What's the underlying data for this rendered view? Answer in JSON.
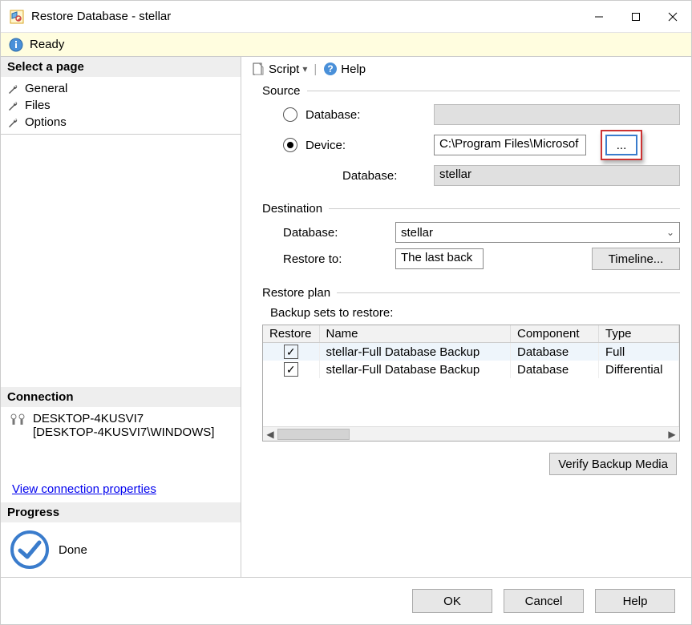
{
  "window": {
    "title": "Restore Database - stellar"
  },
  "status": {
    "text": "Ready"
  },
  "sidebar": {
    "header_pages": "Select a page",
    "pages": [
      {
        "label": "General"
      },
      {
        "label": "Files"
      },
      {
        "label": "Options"
      }
    ],
    "header_connection": "Connection",
    "connection_line1": "DESKTOP-4KUSVI7",
    "connection_line2": "[DESKTOP-4KUSVI7\\WINDOWS]",
    "view_conn_link": "View connection properties",
    "header_progress": "Progress",
    "progress_label": "Done"
  },
  "toolbar": {
    "script_label": "Script",
    "help_label": "Help"
  },
  "source": {
    "header": "Source",
    "database_label": "Database:",
    "device_label": "Device:",
    "device_path": "C:\\Program Files\\Microsof",
    "browse_ellipsis": "...",
    "nested_database_label": "Database:",
    "nested_database_value": "stellar"
  },
  "destination": {
    "header": "Destination",
    "database_label": "Database:",
    "database_value": "stellar",
    "restore_to_label": "Restore to:",
    "restore_to_value": "The last back",
    "timeline_btn": "Timeline..."
  },
  "restore_plan": {
    "header": "Restore plan",
    "subheader": "Backup sets to restore:",
    "columns": {
      "restore": "Restore",
      "name": "Name",
      "component": "Component",
      "type": "Type"
    },
    "rows": [
      {
        "checked": true,
        "name": "stellar-Full Database Backup",
        "component": "Database",
        "type": "Full"
      },
      {
        "checked": true,
        "name": "stellar-Full Database Backup",
        "component": "Database",
        "type": "Differential"
      }
    ],
    "verify_btn": "Verify Backup Media"
  },
  "footer": {
    "ok": "OK",
    "cancel": "Cancel",
    "help": "Help"
  }
}
